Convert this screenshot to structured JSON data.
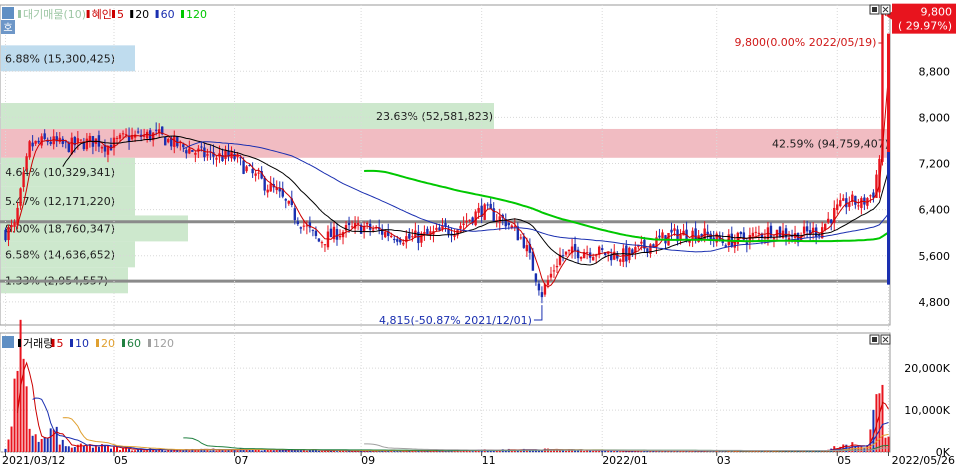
{
  "price_panel": {
    "legend": [
      {
        "text": "대기매물(10)",
        "color": "#9ec7a5"
      },
      {
        "text": "혜인",
        "color": "#cc0000"
      },
      {
        "text": "5",
        "color": "#cc0000"
      },
      {
        "text": "20",
        "color": "#000000"
      },
      {
        "text": "60",
        "color": "#1a2fb0"
      },
      {
        "text": "120",
        "color": "#00c800"
      }
    ],
    "ma_markers": [
      "#cc0000",
      "#000000",
      "#1a2fb0",
      "#00c800"
    ],
    "tab_label": "호",
    "current_price_label": "9,800",
    "current_change_label": "( 29.97%)",
    "high_annotation": "9,800(0.00% 2022/05/19)",
    "low_annotation": "4,815(-50.87% 2021/12/01)"
  },
  "volume_panel": {
    "legend": [
      {
        "text": "거래량",
        "color": "#000000"
      },
      {
        "text": "5",
        "color": "#cc0000"
      },
      {
        "text": "10",
        "color": "#1a2fb0"
      },
      {
        "text": "20",
        "color": "#e0a030"
      },
      {
        "text": "60",
        "color": "#208040"
      },
      {
        "text": "120",
        "color": "#a0a0a0"
      }
    ]
  },
  "x_axis_labels": [
    {
      "label": "2021/03/12",
      "index": 0
    },
    {
      "label": "05",
      "index": 36
    },
    {
      "label": "07",
      "index": 76
    },
    {
      "label": "09",
      "index": 118
    },
    {
      "label": "11",
      "index": 158
    },
    {
      "label": "2022/01",
      "index": 198
    },
    {
      "label": "03",
      "index": 236
    },
    {
      "label": "05",
      "index": 276
    },
    {
      "label": "2022/05/26",
      "index": 293
    }
  ],
  "chart_data": {
    "type": "candlestick",
    "y_ticks": [
      4800,
      5600,
      6400,
      7200,
      8000,
      8800
    ],
    "y_tick_labels": [
      "4,800",
      "5,600",
      "6,400",
      "7,200",
      "8,000",
      "8,800"
    ],
    "ylim": [
      4400,
      9950
    ],
    "volume_ticks": [
      0,
      10000,
      20000
    ],
    "volume_tick_labels": [
      "0K",
      "10,000K",
      "20,000K"
    ],
    "volume_ylim": [
      0,
      26000
    ],
    "price_keypoints": [
      [
        0,
        6000
      ],
      [
        3,
        6100
      ],
      [
        8,
        7500
      ],
      [
        14,
        7600
      ],
      [
        20,
        7500
      ],
      [
        30,
        7600
      ],
      [
        34,
        7500
      ],
      [
        40,
        7650
      ],
      [
        50,
        7700
      ],
      [
        58,
        7500
      ],
      [
        66,
        7350
      ],
      [
        76,
        7300
      ],
      [
        82,
        7000
      ],
      [
        90,
        6700
      ],
      [
        96,
        6300
      ],
      [
        104,
        5850
      ],
      [
        110,
        6000
      ],
      [
        118,
        6100
      ],
      [
        126,
        6000
      ],
      [
        134,
        5900
      ],
      [
        140,
        5950
      ],
      [
        150,
        6100
      ],
      [
        158,
        6400
      ],
      [
        166,
        6200
      ],
      [
        172,
        5850
      ],
      [
        176,
        5250
      ],
      [
        178,
        4950
      ],
      [
        184,
        5600
      ],
      [
        192,
        5700
      ],
      [
        198,
        5650
      ],
      [
        206,
        5600
      ],
      [
        212,
        5750
      ],
      [
        220,
        5950
      ],
      [
        230,
        6000
      ],
      [
        238,
        5850
      ],
      [
        246,
        5900
      ],
      [
        254,
        6050
      ],
      [
        262,
        5950
      ],
      [
        270,
        6050
      ],
      [
        276,
        6400
      ],
      [
        280,
        6550
      ],
      [
        284,
        6500
      ],
      [
        288,
        6700
      ],
      [
        290,
        7300
      ],
      [
        291,
        9800
      ],
      [
        292,
        9800
      ]
    ],
    "volume_keypoints": [
      [
        0,
        500
      ],
      [
        2,
        8000
      ],
      [
        5,
        22000
      ],
      [
        8,
        6000
      ],
      [
        12,
        2500
      ],
      [
        16,
        5000
      ],
      [
        20,
        1200
      ],
      [
        30,
        1500
      ],
      [
        40,
        700
      ],
      [
        60,
        500
      ],
      [
        80,
        600
      ],
      [
        100,
        400
      ],
      [
        140,
        300
      ],
      [
        176,
        600
      ],
      [
        200,
        300
      ],
      [
        240,
        250
      ],
      [
        270,
        300
      ],
      [
        280,
        1800
      ],
      [
        286,
        1500
      ],
      [
        290,
        14000
      ],
      [
        291,
        16000
      ],
      [
        292,
        5000
      ]
    ],
    "ma_settings": [
      5,
      20,
      60,
      120
    ],
    "supply_zones": [
      {
        "label": "6.88% (15,300,425)",
        "pct": 6.88,
        "low": 8800,
        "high": 9250,
        "color": "#b8d8ec"
      },
      {
        "label": "23.63% (52,581,823)",
        "pct": 23.63,
        "low": 7800,
        "high": 8250,
        "color": "#c8e6c8"
      },
      {
        "label": "42.59% (94,759,407)",
        "pct": 42.59,
        "low": 7300,
        "high": 7800,
        "color": "#efb5bb"
      },
      {
        "label": "4.64% (10,329,341)",
        "pct": 4.64,
        "low": 6800,
        "high": 7300,
        "color": "#c8e6c8"
      },
      {
        "label": "5.47% (12,171,220)",
        "pct": 5.47,
        "low": 6300,
        "high": 6800,
        "color": "#c8e6c8"
      },
      {
        "label": "8.00% (18,760,347)",
        "pct": 8.0,
        "low": 5850,
        "high": 6300,
        "color": "#c8e6c8"
      },
      {
        "label": "6.58% (14,636,652)",
        "pct": 6.58,
        "low": 5400,
        "high": 5850,
        "color": "#c8e6c8"
      },
      {
        "label": "1.33% (2,954,557)",
        "pct": 1.33,
        "low": 4950,
        "high": 5400,
        "color": "#c8e6c8"
      }
    ],
    "support_lines": [
      6190,
      5160
    ],
    "high": {
      "price": 9800,
      "date": "2022/05/19"
    },
    "low": {
      "price": 4815,
      "date": "2021/12/01"
    }
  },
  "colors": {
    "up": "#e8141e",
    "down": "#1a2fb0",
    "current_badge": "#e8141e",
    "grid": "#b4b4b4"
  },
  "icons": [
    "window-icon",
    "close-icon"
  ]
}
